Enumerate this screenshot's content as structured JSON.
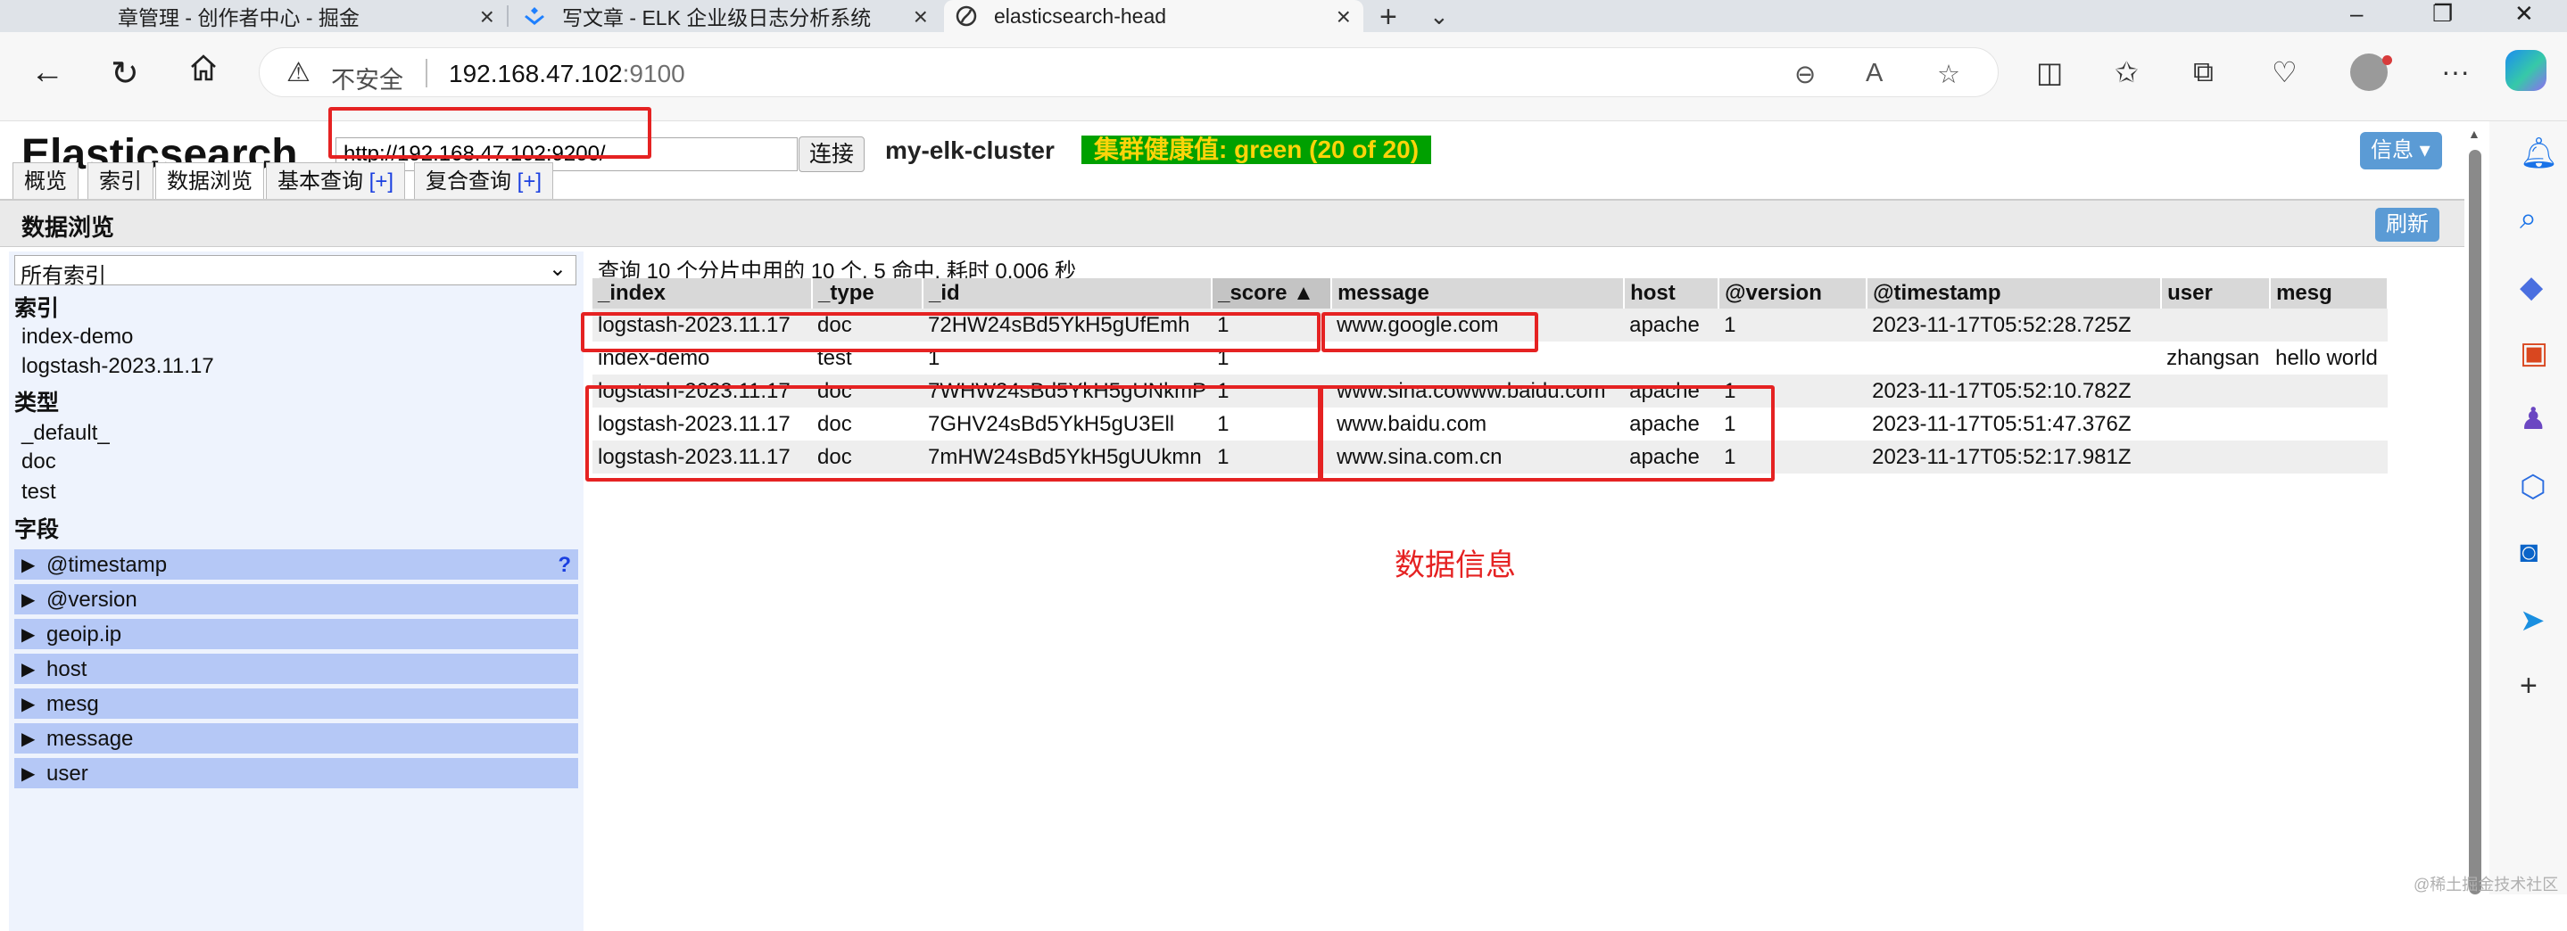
{
  "browser": {
    "tabs": [
      {
        "title": "章管理 - 创作者中心 - 掘金"
      },
      {
        "title": "写文章 - ELK 企业级日志分析系统"
      },
      {
        "title": "elasticsearch-head"
      }
    ],
    "address": {
      "warning": "不安全",
      "host": "192.168.47.102",
      "port": ":9100"
    }
  },
  "es": {
    "logo": "Elasticsearch",
    "connect_url": "http://192.168.47.102:9200/",
    "connect_label": "连接",
    "cluster_name": "my-elk-cluster",
    "health": "集群健康值: green (20 of 20)",
    "health_color": "#00a000",
    "info_label": "信息 ▾",
    "nav": [
      {
        "label": "概览"
      },
      {
        "label": "索引"
      },
      {
        "label": "数据浏览"
      },
      {
        "label": "基本查询",
        "plus": "[+]"
      },
      {
        "label": "复合查询",
        "plus": "[+]"
      }
    ],
    "section_title": "数据浏览",
    "refresh_label": "刷新"
  },
  "filter": {
    "selected_index": "所有索引",
    "indices_label": "索引",
    "indices": [
      "index-demo",
      "logstash-2023.11.17"
    ],
    "types_label": "类型",
    "types": [
      "_default_",
      "doc",
      "test"
    ],
    "fields_label": "字段",
    "fields": [
      "@timestamp",
      "@version",
      "geoip.ip",
      "host",
      "mesg",
      "message",
      "user"
    ],
    "help_mark": "?"
  },
  "results": {
    "summary": "查询 10 个分片中用的 10 个. 5 命中. 耗时 0.006 秒",
    "columns": [
      "_index",
      "_type",
      "_id",
      "_score ▲",
      "message",
      "host",
      "@version",
      "@timestamp",
      "user",
      "mesg"
    ],
    "rows": [
      [
        "logstash-2023.11.17",
        "doc",
        "72HW24sBd5YkH5gUfEmh",
        "1",
        "www.google.com",
        "apache",
        "1",
        "2023-11-17T05:52:28.725Z",
        "",
        ""
      ],
      [
        "index-demo",
        "test",
        "1",
        "1",
        "",
        "",
        "",
        "",
        "zhangsan",
        "hello world"
      ],
      [
        "logstash-2023.11.17",
        "doc",
        "7WHW24sBd5YkH5gUNkmP",
        "1",
        "www.sina.cowww.baidu.com",
        "apache",
        "1",
        "2023-11-17T05:52:10.782Z",
        "",
        ""
      ],
      [
        "logstash-2023.11.17",
        "doc",
        "7GHV24sBd5YkH5gU3Ell",
        "1",
        "www.baidu.com",
        "apache",
        "1",
        "2023-11-17T05:51:47.376Z",
        "",
        ""
      ],
      [
        "logstash-2023.11.17",
        "doc",
        "7mHW24sBd5YkH5gUUkmn",
        "1",
        "www.sina.com.cn",
        "apache",
        "1",
        "2023-11-17T05:52:17.981Z",
        "",
        ""
      ]
    ]
  },
  "annotation": {
    "label": "数据信息",
    "color": "#e52222"
  },
  "watermark": "@稀土掘金技术社区"
}
